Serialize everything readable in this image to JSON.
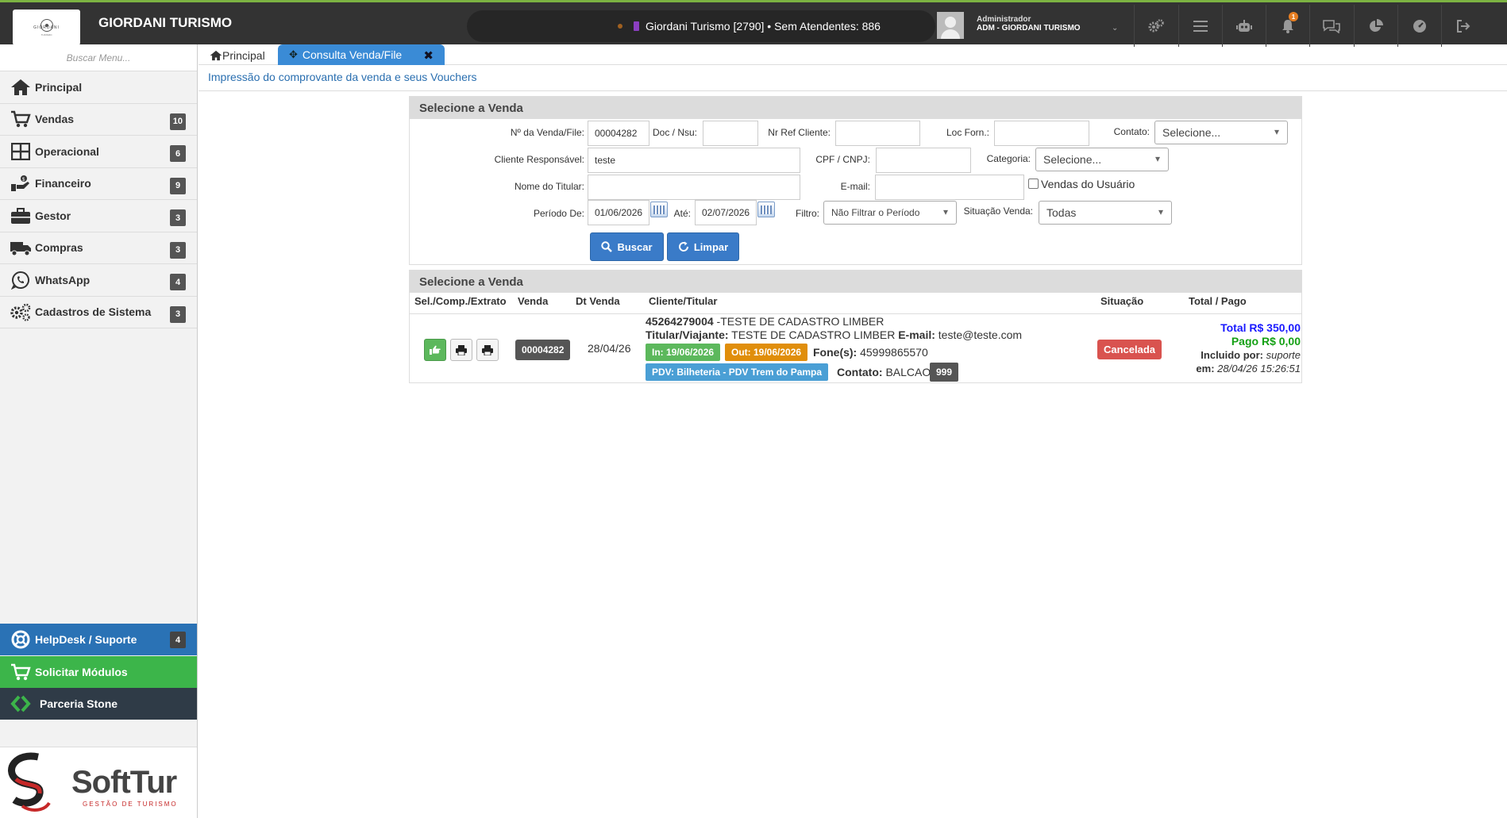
{
  "app": {
    "brand": "GIORDANI TURISMO",
    "logo_text": "GIORDANI",
    "logo_sub": "TURISMO",
    "agency_info": "Giordani Turismo [2790] • Sem Atendentes: 886",
    "user_role": "Administrador",
    "user_name": "ADM - GIORDANI TURISMO",
    "notification_count": "1"
  },
  "sidebar": {
    "search_placeholder": "Buscar Menu...",
    "items": [
      {
        "label": "Principal",
        "icon": "home-icon",
        "badge": ""
      },
      {
        "label": "Vendas",
        "icon": "cart-icon",
        "badge": "10"
      },
      {
        "label": "Operacional",
        "icon": "grid-icon",
        "badge": "6"
      },
      {
        "label": "Financeiro",
        "icon": "money-icon",
        "badge": "9"
      },
      {
        "label": "Gestor",
        "icon": "briefcase-icon",
        "badge": "3"
      },
      {
        "label": "Compras",
        "icon": "truck-icon",
        "badge": "3"
      },
      {
        "label": "WhatsApp",
        "icon": "whatsapp-icon",
        "badge": "4"
      },
      {
        "label": "Cadastros de Sistema",
        "icon": "gears-icon",
        "badge": "3"
      }
    ],
    "helpdesk": {
      "label": "HelpDesk / Suporte",
      "badge": "4"
    },
    "modules": {
      "label": "Solicitar Módulos"
    },
    "stone": {
      "label": "Parceria Stone"
    },
    "softtur": {
      "name": "SoftTur",
      "tagline": "GESTÃO DE TURISMO"
    }
  },
  "tabs": {
    "home": "Principal",
    "active": "Consulta Venda/File"
  },
  "page": {
    "subtitle": "Impressão do comprovante da venda e seus Vouchers"
  },
  "form": {
    "title": "Selecione a Venda",
    "venda_label": "Nº da Venda/File:",
    "venda_value": "00004282",
    "doc_label": "Doc / Nsu:",
    "doc_value": "",
    "nrref_label": "Nr Ref Cliente:",
    "nrref_value": "",
    "locforn_label": "Loc Forn.:",
    "locforn_value": "",
    "contato_label": "Contato:",
    "contato_value": "Selecione...",
    "cliente_label": "Cliente Responsável:",
    "cliente_value": "teste",
    "cpf_label": "CPF / CNPJ:",
    "cpf_value": "",
    "categoria_label": "Categoria:",
    "categoria_value": "Selecione...",
    "titular_label": "Nome do Titular:",
    "titular_value": "",
    "email_label": "E-mail:",
    "email_value": "",
    "vendas_usuario_label": "Vendas do Usuário",
    "vendas_usuario_checked": false,
    "periodo_label": "Período De:",
    "periodo_de": "01/06/2026",
    "ate_label": "Até:",
    "periodo_ate": "02/07/2026",
    "filtro_label": "Filtro:",
    "filtro_value": "Não Filtrar o Período",
    "situacao_label": "Situação Venda:",
    "situacao_value": "Todas",
    "buscar_label": "Buscar",
    "limpar_label": "Limpar"
  },
  "results": {
    "title": "Selecione a Venda",
    "columns": [
      "Sel./Comp./Extrato",
      "Venda",
      "Dt Venda",
      "Cliente/Titular",
      "Situação",
      "Total / Pago"
    ],
    "rows": [
      {
        "venda": "00004282",
        "dt_venda": "28/04/26",
        "cliente_code": "45264279004",
        "cliente_name": " -TESTE DE CADASTRO LIMBER",
        "titular_label": "Titular/Viajante:",
        "titular": "TESTE DE CADASTRO LIMBER",
        "email_label": "E-mail:",
        "email": "teste@teste.com",
        "in_date": "In: 19/06/2026",
        "out_date": "Out: 19/06/2026",
        "fone_label": "Fone(s):",
        "fone": "45999865570",
        "pdv": "PDV: Bilheteria - PDV Trem do Pampa",
        "contato_label": "Contato:",
        "contato": "BALCAO",
        "contato_badge": "999",
        "situacao": "Cancelada",
        "total": "Total R$ 350,00",
        "pago": "Pago R$ 0,00",
        "incluido_label": "Incluido por:",
        "incluido_por": "suporte",
        "em_label": "em:",
        "em": "28/04/26 15:26:51"
      }
    ]
  },
  "colors": {
    "topbar": "#333333",
    "accent_green": "#7cb342",
    "tab_blue": "#3a8bd6",
    "status_red": "#d9534f"
  }
}
